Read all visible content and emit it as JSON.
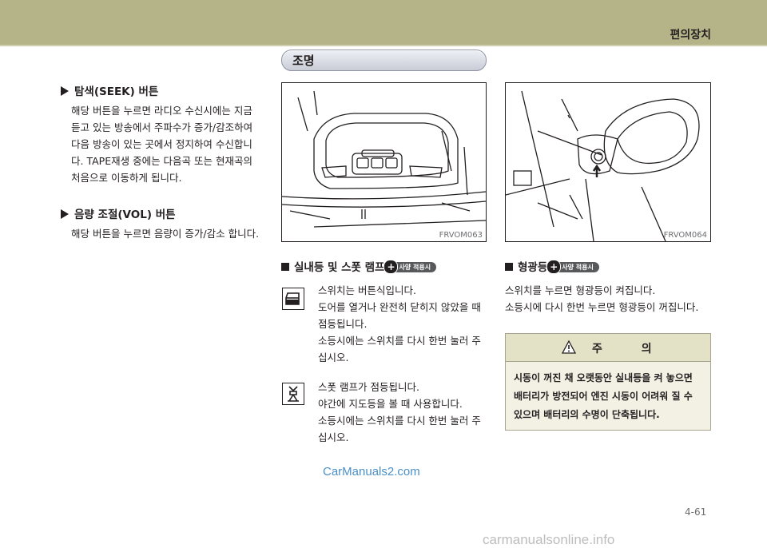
{
  "header": {
    "section": "편의장치"
  },
  "pill_title": "조명",
  "left": {
    "seek": {
      "heading": "탐색(SEEK) 버튼",
      "lines": [
        "해당 버튼을 누르면 라디오 수신시에는 지금",
        "듣고 있는 방송에서 주파수가 증가/감조하여",
        "다음 방송이 있는 곳에서 정지하여 수신합니",
        "다. TAPE재생 중에는 다음곡 또는 현재곡의",
        "처음으로 이동하게 됩니다."
      ]
    },
    "vol": {
      "heading": "음량 조절(VOL) 버튼",
      "lines": [
        "해당 버튼을 누르면 음량이 증가/감소 합니다."
      ]
    }
  },
  "figures": {
    "fig1_caption": "FRVOM063",
    "fig2_caption": "FRVOM064"
  },
  "interior": {
    "heading": "실내등 및 스폿 램프",
    "badge": "사양 적용시",
    "door_icon": "door-switch-icon",
    "text1": [
      "스위치는 버튼식입니다.",
      "도어를 열거나 완전히 닫히지 않았을 때",
      "점등됩니다.",
      "소등시에는 스위치를 다시 한번 눌러 주",
      "십시오."
    ],
    "spot_icon": "spot-lamp-icon",
    "text2": [
      "스폿 램프가 점등됩니다.",
      "야간에 지도등을 볼 때 사용합니다.",
      "소등시에는 스위치를 다시 한번 눌러 주",
      "십시오."
    ]
  },
  "glow": {
    "heading": "형광등",
    "badge": "사양 적용시",
    "lines": [
      "스위치를 누르면 형광등이 켜집니다.",
      "소등시에 다시 한번 누르면 형광등이 꺼집니다."
    ]
  },
  "caution": {
    "title": "주 의",
    "icon": "warning-triangle-icon",
    "lines": [
      "시동이 꺼진 채 오랫동안 실내등을 켜 놓으면",
      "배터리가 방전되어 엔진 시동이 어려워 질 수",
      "있으며 배터리의 수명이 단축됩니다."
    ]
  },
  "watermark": "CarManuals2.com",
  "page_number": "4-61",
  "footer_site": "carmanualsonline.info"
}
